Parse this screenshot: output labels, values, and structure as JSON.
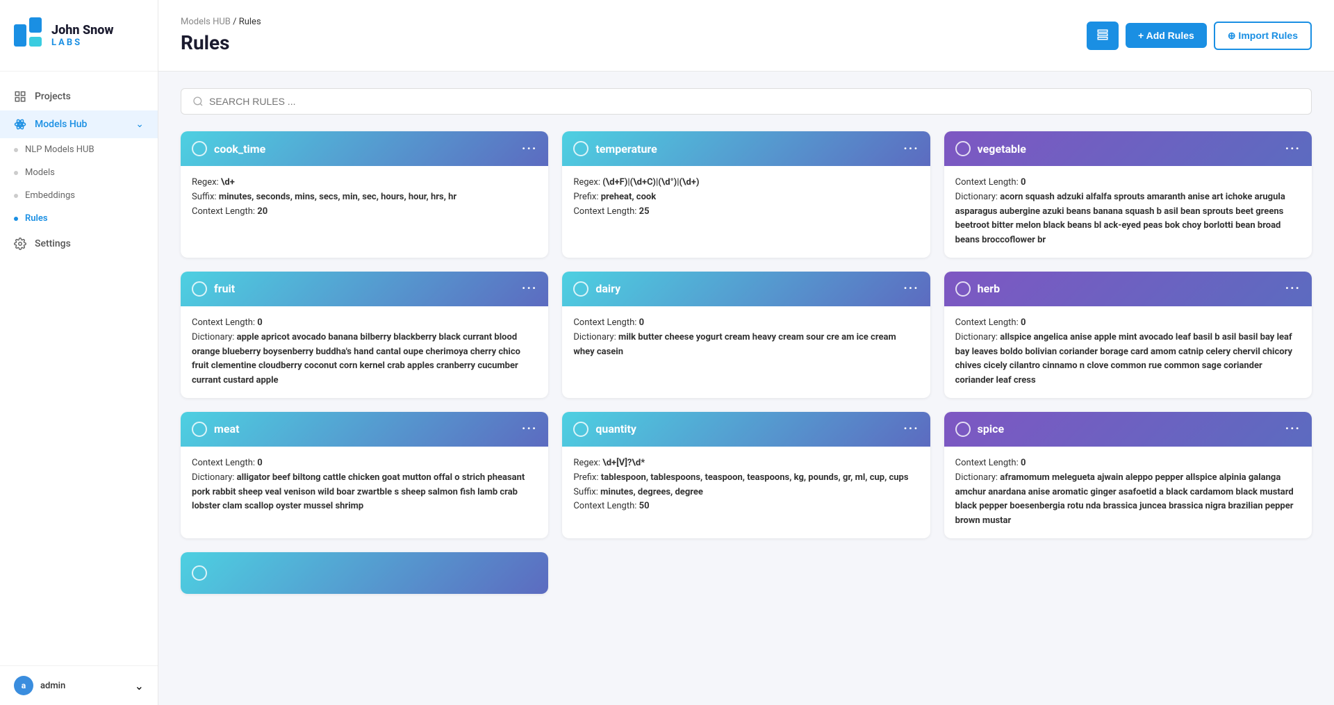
{
  "logo": {
    "name_line1": "John Snow",
    "name_line2": "LABS"
  },
  "sidebar": {
    "items": [
      {
        "id": "projects",
        "label": "Projects",
        "icon": "grid-icon",
        "active": false
      },
      {
        "id": "models-hub",
        "label": "Models Hub",
        "icon": "atom-icon",
        "active": true,
        "expanded": true
      },
      {
        "id": "settings",
        "label": "Settings",
        "icon": "gear-icon",
        "active": false
      }
    ],
    "sub_items": [
      {
        "id": "nlp-models",
        "label": "NLP Models HUB",
        "active": false
      },
      {
        "id": "models",
        "label": "Models",
        "active": false
      },
      {
        "id": "embeddings",
        "label": "Embeddings",
        "active": false
      },
      {
        "id": "rules",
        "label": "Rules",
        "active": true
      }
    ],
    "footer": {
      "avatar_letter": "a",
      "username": "admin"
    }
  },
  "header": {
    "breadcrumb_parent": "Models HUB",
    "breadcrumb_separator": "/ Rules",
    "title": "Rules",
    "btn_icon_title": "list-view",
    "btn_add_label": "+ Add Rules",
    "btn_import_label": "⊕ Import Rules"
  },
  "search": {
    "placeholder": "SEARCH RULES ..."
  },
  "cards": [
    {
      "id": "cook_time",
      "name": "cook_time",
      "gradient": "grad-cook",
      "fields": [
        {
          "label": "Regex: ",
          "value": "\\d+"
        },
        {
          "label": "Suffix: ",
          "value": "minutes, seconds, mins, secs, min, sec, hours, hour, hrs, hr"
        },
        {
          "label": "Context Length: ",
          "value": "20"
        }
      ]
    },
    {
      "id": "temperature",
      "name": "temperature",
      "gradient": "grad-temp",
      "fields": [
        {
          "label": "Regex: ",
          "value": "(\\d+F)|(\\d+C)|(\\d°)|(\\d+)"
        },
        {
          "label": "Prefix: ",
          "value": "preheat, cook"
        },
        {
          "label": "Context Length: ",
          "value": "25"
        }
      ]
    },
    {
      "id": "vegetable",
      "name": "vegetable",
      "gradient": "grad-veg",
      "fields": [
        {
          "label": "Context Length: ",
          "value": "0"
        },
        {
          "label": "Dictionary: ",
          "value": "acorn squash adzuki alfalfa sprouts amaranth anise art ichoke arugula asparagus aubergine azuki beans banana squash b asil bean sprouts beet greens beetroot bitter melon black beans bl ack-eyed peas bok choy borlotti bean broad beans broccoflower br"
        }
      ]
    },
    {
      "id": "fruit",
      "name": "fruit",
      "gradient": "grad-fruit",
      "fields": [
        {
          "label": "Context Length: ",
          "value": "0"
        },
        {
          "label": "Dictionary: ",
          "value": "apple apricot avocado banana bilberry blackberry black currant blood orange blueberry boysenberry buddha's hand cantal oupe cherimoya cherry chico fruit clementine cloudberry coconut corn kernel crab apples cranberry cucumber currant custard apple"
        }
      ]
    },
    {
      "id": "dairy",
      "name": "dairy",
      "gradient": "grad-dairy",
      "fields": [
        {
          "label": "Context Length: ",
          "value": "0"
        },
        {
          "label": "Dictionary: ",
          "value": "milk butter cheese yogurt cream heavy cream sour cre am ice cream whey casein"
        }
      ]
    },
    {
      "id": "herb",
      "name": "herb",
      "gradient": "grad-herb",
      "fields": [
        {
          "label": "Context Length: ",
          "value": "0"
        },
        {
          "label": "Dictionary: ",
          "value": "allspice angelica anise apple mint avocado leaf basil b asil basil bay leaf bay leaves boldo bolivian coriander borage card amom catnip celery chervil chicory chives cicely cilantro cinnamo n clove common rue common sage coriander coriander leaf cress"
        }
      ]
    },
    {
      "id": "meat",
      "name": "meat",
      "gradient": "grad-meat",
      "fields": [
        {
          "label": "Context Length: ",
          "value": "0"
        },
        {
          "label": "Dictionary: ",
          "value": "alligator beef biltong cattle chicken goat mutton offal o strich pheasant pork rabbit sheep veal venison wild boar zwartble s sheep salmon fish lamb crab lobster clam scallop oyster mussel shrimp"
        }
      ]
    },
    {
      "id": "quantity",
      "name": "quantity",
      "gradient": "grad-qty",
      "fields": [
        {
          "label": "Regex: ",
          "value": "\\d+[V]?\\d*"
        },
        {
          "label": "Prefix: ",
          "value": "tablespoon, tablespoons, teaspoon, teaspoons, kg, pounds, gr, ml, cup, cups"
        },
        {
          "label": "Suffix: ",
          "value": "minutes, degrees, degree"
        },
        {
          "label": "Context Length: ",
          "value": "50"
        }
      ]
    },
    {
      "id": "spice",
      "name": "spice",
      "gradient": "grad-spice",
      "fields": [
        {
          "label": "Context Length: ",
          "value": "0"
        },
        {
          "label": "Dictionary: ",
          "value": "aframomum melegueta ajwain aleppo pepper allspice alpinia galanga amchur anardana anise aromatic ginger asafoetid a black cardamom black mustard black pepper boesenbergia rotu nda brassica juncea brassica nigra brazilian pepper brown mustar"
        }
      ]
    },
    {
      "id": "extra",
      "name": "...",
      "gradient": "grad-extra",
      "fields": []
    }
  ],
  "dots_label": "···"
}
